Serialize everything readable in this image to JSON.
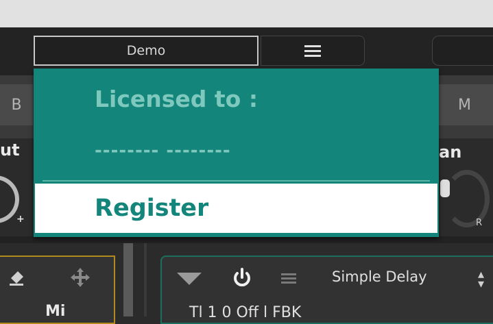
{
  "header": {
    "preset_label": "Demo"
  },
  "strip": {
    "button_b": "B",
    "button_m": "M",
    "label_left": "ut",
    "label_right": "an",
    "knob_left_sign": "+",
    "knob_right_label": "R"
  },
  "popup": {
    "licensed_to": "Licensed to :",
    "licensee": "-------- --------",
    "register": "Register",
    "background_color": "#13857a"
  },
  "fx_left": {
    "label": "Mi"
  },
  "fx_slot": {
    "name": "Simple Delay",
    "param_text": "Tl       1 0 Off   l   FBK"
  }
}
